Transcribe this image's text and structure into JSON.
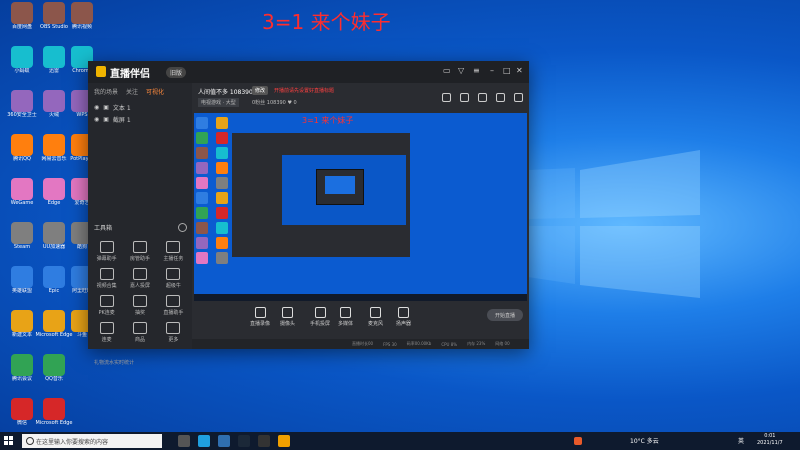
{
  "overlay_text": "3=1 来个妹子",
  "desktop_col1": [
    "百度网盘",
    "小蚂蚁",
    "360安全卫士",
    "腾讯QQ",
    "WeGame",
    "Steam",
    "英雄联盟",
    "新建文本",
    "腾讯会议",
    "微信"
  ],
  "desktop_col2": [
    "OBS Studio",
    "迅雷",
    "火绒",
    "网易云音乐",
    "Edge",
    "UU加速器",
    "Epic",
    "Microsoft Edge",
    "QQ音乐",
    "Microsoft Edge"
  ],
  "desktop_col3": [
    "腾讯视频",
    "Chrome",
    "WPS",
    "PotPlayer",
    "爱奇艺",
    "酷狗",
    "阿里旺旺",
    "斗鱼"
  ],
  "app": {
    "name": "直播伴侣",
    "version": "旧版",
    "side_tabs": [
      "我的场景",
      "关注",
      "可视化"
    ],
    "scenes": [
      "文本 1",
      "截屏 1"
    ],
    "tools_title": "工具箱",
    "tools": [
      "弹幕助手",
      "房管助手",
      "主播任务",
      "视频合集",
      "嘉人投屏",
      "超级牛",
      "PK连麦",
      "抽奖",
      "直播助手",
      "连麦",
      "商品",
      "更多"
    ],
    "footer": "礼物流水实时统计",
    "room_title": "人间值不多 108390",
    "edit_label": "修改",
    "red_note": "开播前请先设置好直播标题",
    "category": "电视游戏 · 大型",
    "stats": "0粉丝   108390   ♥ 0",
    "preview_text": "3=1 来个妹子",
    "bottom_buttons": [
      "直播录像",
      "摄像头",
      "手机投屏",
      "多媒体",
      "麦克风",
      "扬声器"
    ],
    "live_button": "开始直播",
    "status_items": [
      "直播时长00",
      "FPS 30",
      "码率00.00Kb",
      "CPU 8%",
      "内存 23%",
      "网络 00"
    ]
  },
  "taskbar": {
    "search_placeholder": "在这里输入你要搜索的内容",
    "weather": "10°C  多云",
    "ime": "英",
    "time": "0:01",
    "date": "2021/11/7"
  },
  "colors": {
    "accent": "#ff8a3d",
    "overlay": "#ff2d2d",
    "desktop": "#0a57c7"
  }
}
